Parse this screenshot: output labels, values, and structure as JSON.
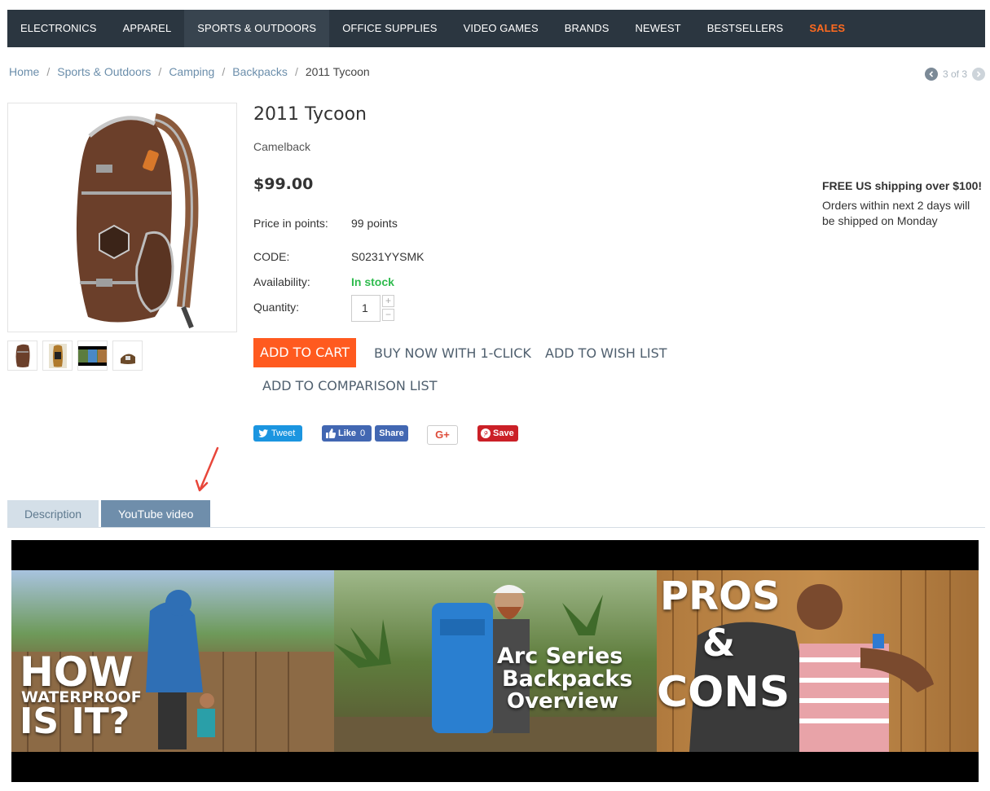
{
  "nav": {
    "items": [
      {
        "label": "ELECTRONICS"
      },
      {
        "label": "APPAREL"
      },
      {
        "label": "SPORTS & OUTDOORS"
      },
      {
        "label": "OFFICE SUPPLIES"
      },
      {
        "label": "VIDEO GAMES"
      },
      {
        "label": "BRANDS"
      },
      {
        "label": "NEWEST"
      },
      {
        "label": "BESTSELLERS"
      },
      {
        "label": "SALES"
      }
    ]
  },
  "breadcrumb": {
    "home": "Home",
    "category": "Sports & Outdoors",
    "subcategory": "Camping",
    "subsubcategory": "Backpacks",
    "current": "2011 Tycoon",
    "separator": "/"
  },
  "pager": {
    "text": "3 of 3"
  },
  "product": {
    "title": "2011 Tycoon",
    "brand": "Camelback",
    "price": "$99.00",
    "points_label": "Price in points:",
    "points_value": "99 points",
    "code_label": "CODE:",
    "code_value": "S0231YYSMK",
    "availability_label": "Availability:",
    "availability_value": "In stock",
    "quantity_label": "Quantity:",
    "quantity_value": "1"
  },
  "shipping": {
    "headline": "FREE US shipping over $100!",
    "note": "Orders within next 2 days will be shipped on Monday"
  },
  "actions": {
    "add_to_cart": "ADD TO CART",
    "buy_now": "BUY NOW WITH 1-CLICK",
    "wish_list": "ADD TO WISH LIST",
    "comparison": "ADD TO COMPARISON LIST"
  },
  "social": {
    "tweet": "Tweet",
    "like": "Like",
    "like_count": "0",
    "share": "Share",
    "gplus": "G+",
    "save": "Save"
  },
  "tabs": [
    {
      "label": "Description"
    },
    {
      "label": "YouTube video"
    }
  ],
  "video": {
    "panel1_line1": "HOW",
    "panel1_line2": "WATERPROOF",
    "panel1_line3": "IS IT?",
    "panel2_line1": "Arc Series",
    "panel2_line2": "Backpacks",
    "panel2_line3": "Overview",
    "panel3_line1": "PROS",
    "panel3_line2": "&",
    "panel3_line3": "CONS"
  },
  "colors": {
    "nav_bg": "#2b3640",
    "sales": "#ff6a1f",
    "cart_button": "#ff5a1f",
    "in_stock": "#2fbb4e",
    "tab_active": "#6f8eab",
    "annotation": "#e8463a"
  }
}
